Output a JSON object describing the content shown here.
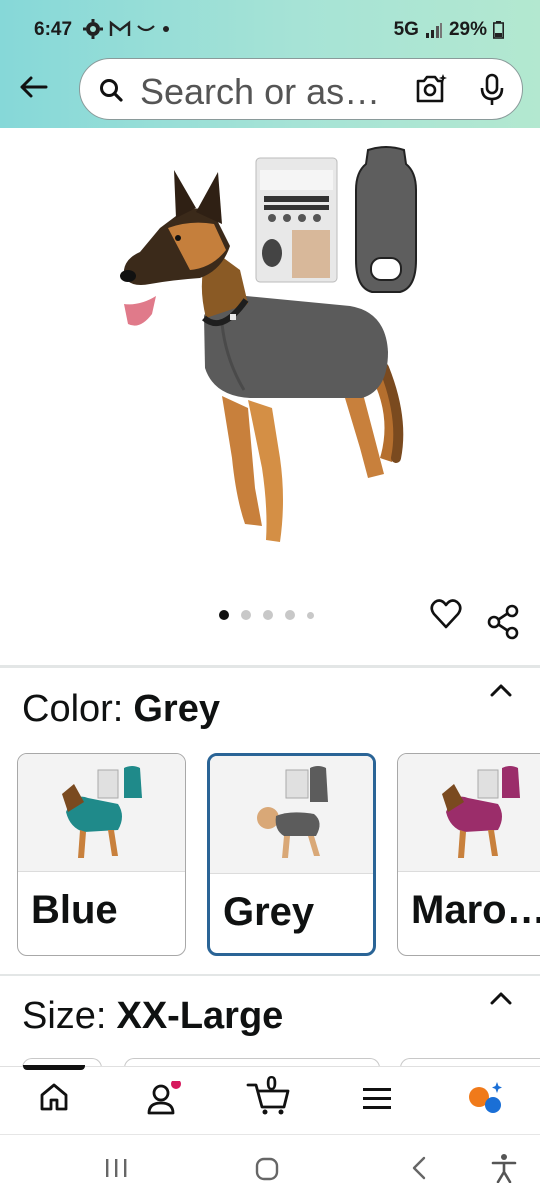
{
  "status": {
    "time": "6:47",
    "network": "5G",
    "battery": "29%"
  },
  "header": {
    "search_placeholder": "Search or as…"
  },
  "gallery": {
    "image_count": 5,
    "active_index": 0
  },
  "color": {
    "label": "Color:",
    "selected": "Grey",
    "options": [
      {
        "name": "Blue",
        "suit_color": "#1f8a8a"
      },
      {
        "name": "Grey",
        "suit_color": "#5c5c5c"
      },
      {
        "name": "Maro…",
        "suit_color": "#9b2d6a"
      }
    ]
  },
  "size": {
    "label": "Size:",
    "selected": "XX-Large"
  },
  "nav": {
    "cart_count": "0",
    "items": [
      "home-icon",
      "account-icon",
      "cart-icon",
      "menu-icon",
      "ai-assistant-icon"
    ]
  },
  "accent": {
    "selection_border": "#2a6496",
    "header_from": "#86d8d8",
    "header_to": "#b3e8d0"
  }
}
